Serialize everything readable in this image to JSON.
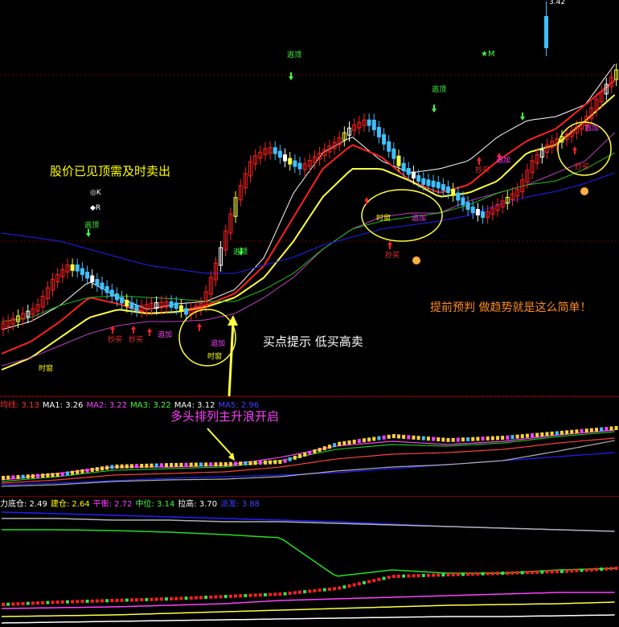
{
  "chart_data": [
    {
      "type": "candlestick",
      "name": "main",
      "price_axis_label": "3.42",
      "grid": true,
      "marks": {
        "K": "◎K",
        "R": "◆R"
      },
      "trend_lines": [
        "white",
        "red",
        "yellow",
        "purple",
        "green",
        "blue"
      ],
      "annotations": {
        "sell_hint": "股价已见顶需及时卖出",
        "buy_hint": "买点提示 低买高卖",
        "slogan": "提前预判 做趋势就是这么简单！",
        "bull_arrange": "多头排列主升浪开启",
        "top1": "逃顶",
        "top2": "逃顶",
        "top3": "逃顶",
        "top4": "逃顶",
        "top5": "逃顶",
        "add1": "追加",
        "add2": "追加",
        "add3": "追加",
        "add4": "追加",
        "add5": "追加",
        "buy1": "抄买",
        "buy2": "抄买",
        "buy3": "抄买",
        "buy4": "抄买",
        "buy5": "抄买",
        "timing1": "时窗",
        "timing2": "时窗",
        "timing3": "时窗",
        "star": "M"
      }
    },
    {
      "type": "line",
      "name": "ma_panel",
      "legend": [
        {
          "label": "均线:",
          "value": "3.13",
          "color": "#ff3030"
        },
        {
          "label": "MA1:",
          "value": "3.26",
          "color": "#ffffff"
        },
        {
          "label": "MA2:",
          "value": "3.22",
          "color": "#ff40ff"
        },
        {
          "label": "MA3:",
          "value": "3.22",
          "color": "#40ff40"
        },
        {
          "label": "MA4:",
          "value": "3.12",
          "color": "#ffffff"
        },
        {
          "label": "MA5:",
          "value": "2.96",
          "color": "#4040ff"
        }
      ]
    },
    {
      "type": "line",
      "name": "cost_panel",
      "legend": [
        {
          "label": "力底仓:",
          "value": "2.49",
          "color": "#ffffff"
        },
        {
          "label": "建仓:",
          "value": "2.64",
          "color": "#ffff00"
        },
        {
          "label": "平衡:",
          "value": "2.72",
          "color": "#ff40ff"
        },
        {
          "label": "中位:",
          "value": "3.14",
          "color": "#40ff40"
        },
        {
          "label": "拉高:",
          "value": "3.70",
          "color": "#ffffff"
        },
        {
          "label": "派发:",
          "value": "3.88",
          "color": "#4040ff"
        }
      ]
    }
  ]
}
